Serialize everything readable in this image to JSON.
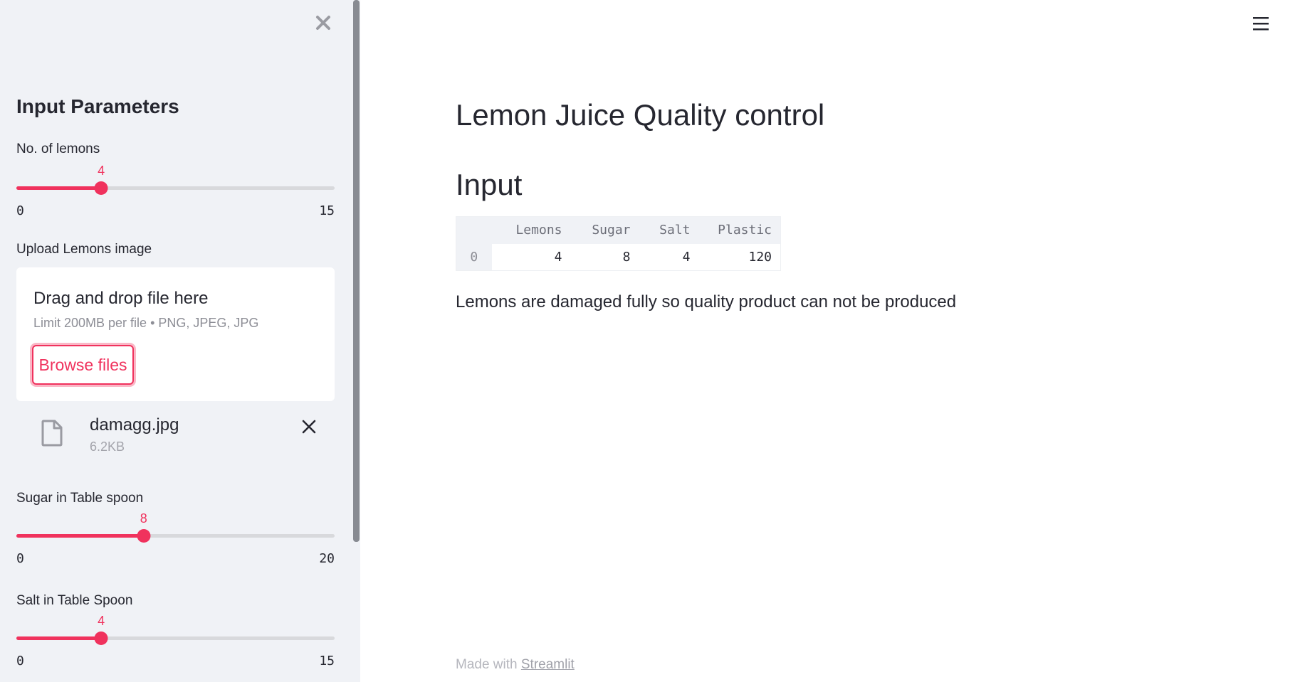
{
  "sidebar": {
    "title": "Input Parameters",
    "lemons_slider": {
      "label": "No. of lemons",
      "value": 4,
      "value_text": "4",
      "min": 0,
      "max": 15,
      "min_text": "0",
      "max_text": "15"
    },
    "uploader": {
      "label": "Upload Lemons image",
      "drag_text": "Drag and drop file here",
      "limit_text": "Limit 200MB per file • PNG, JPEG, JPG",
      "browse_label": "Browse files",
      "file": {
        "name": "damagg.jpg",
        "size": "6.2KB"
      }
    },
    "sugar_slider": {
      "label": "Sugar in Table spoon",
      "value": 8,
      "value_text": "8",
      "min": 0,
      "max": 20,
      "min_text": "0",
      "max_text": "20"
    },
    "salt_slider": {
      "label": "Salt in Table Spoon",
      "value": 4,
      "value_text": "4",
      "min": 0,
      "max": 15,
      "min_text": "0",
      "max_text": "15"
    }
  },
  "main": {
    "title": "Lemon Juice Quality control",
    "subheader": "Input",
    "table": {
      "columns": [
        "Lemons",
        "Sugar",
        "Salt",
        "Plastic"
      ],
      "rows": [
        {
          "index": "0",
          "cells": [
            "4",
            "8",
            "4",
            "120"
          ]
        }
      ]
    },
    "message": "Lemons are damaged fully so quality product can not be produced",
    "footer": {
      "prefix": "Made with ",
      "link": "Streamlit"
    }
  },
  "icons": {
    "close": "close-icon",
    "menu": "hamburger-menu-icon",
    "file": "file-icon",
    "remove": "remove-file-icon"
  },
  "colors": {
    "accent": "#f0325d",
    "sidebar_bg": "#f0f2f6",
    "text": "#262730"
  }
}
